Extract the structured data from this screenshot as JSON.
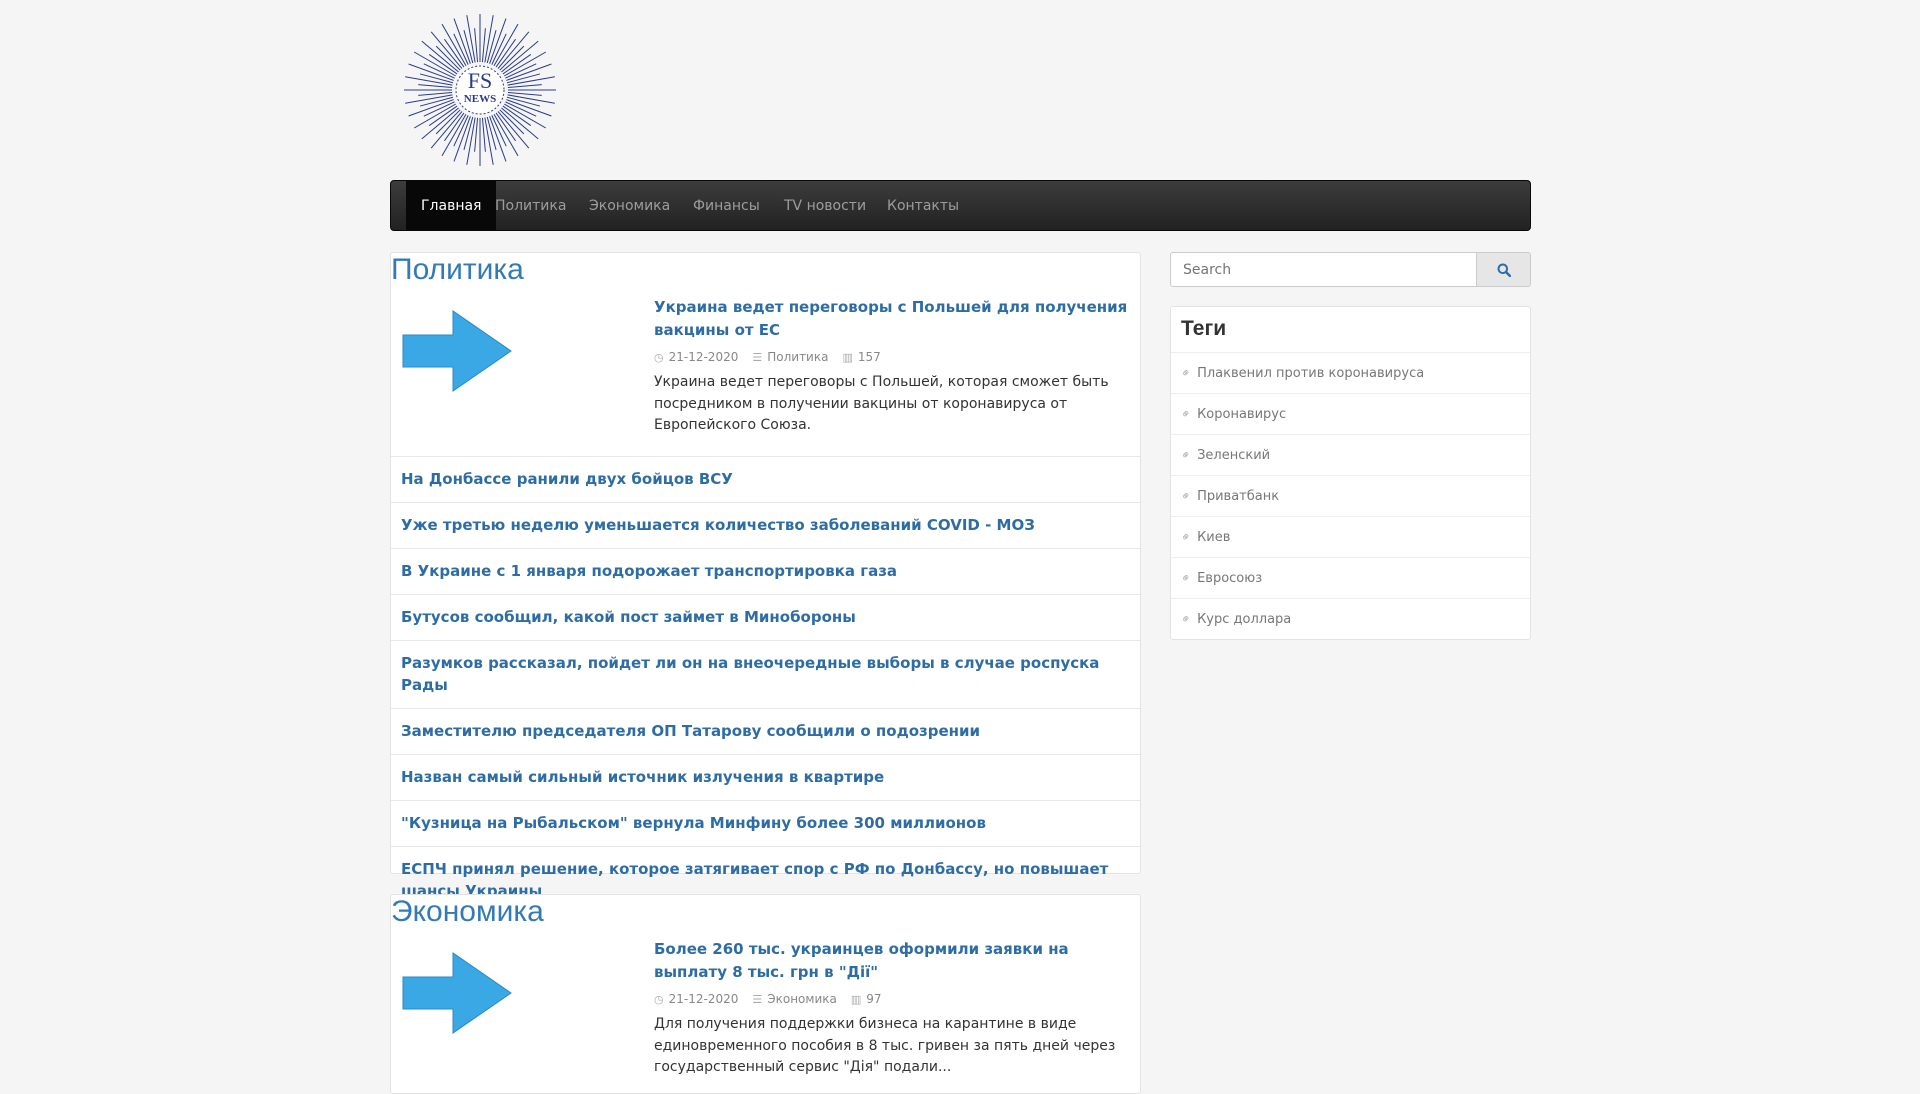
{
  "logo": {
    "line1": "FS",
    "line2": "NEWS"
  },
  "nav": [
    "Главная",
    "Политика",
    "Экономика",
    "Финансы",
    "TV новости",
    "Контакты"
  ],
  "search": {
    "placeholder": "Search"
  },
  "sections": [
    {
      "title": "Политика",
      "lead": {
        "title": "Украина ведет переговоры с Польшей для получения вакцины от ЕС",
        "date": "21-12-2020",
        "category": "Политика",
        "views": "157",
        "text": "Украина ведет переговоры с Польшей, которая сможет быть посредником в получении вакцины от коронавируса от Европейского Союза."
      },
      "items": [
        "На Донбассе ранили двух бойцов ВСУ",
        "Уже третью неделю уменьшается количество заболеваний COVID - МОЗ",
        "В Украине с 1 января подорожает транспортировка газа",
        "Бутусов сообщил, какой пост займет в Минобороны",
        "Разумков рассказал, пойдет ли он на внеочередные выборы в случае роспуска Рады",
        "Заместителю председателя ОП Татарову сообщили о подозрении",
        "Назван самый сильный источник излучения в квартире",
        "\"Кузница на Рыбальском\" вернула Минфину более 300 миллионов",
        "ЕСПЧ принял решение, которое затягивает спор с РФ по Донбассу, но повышает шансы Украины"
      ]
    },
    {
      "title": "Экономика",
      "lead": {
        "title": "Более 260 тыс. украинцев оформили заявки на выплату 8 тыс. грн в \"Дії\"",
        "date": "21-12-2020",
        "category": "Экономика",
        "views": "97",
        "text": "Для получения поддержки бизнеса на карантине в виде единовременного пособия в 8 тыс. гривен за пять дней через государственный сервис \"Дія\" подали..."
      }
    }
  ],
  "tags": {
    "title": "Теги",
    "items": [
      "Плаквенил против коронавируса",
      "Коронавирус",
      "Зеленский",
      "Приватбанк",
      "Киев",
      "Евросоюз",
      "Курс доллара"
    ]
  },
  "colors": {
    "link": "#2e6da4",
    "heading": "#337ab7",
    "arrow": "#3aa8e4",
    "logo": "#2a3a8c"
  }
}
